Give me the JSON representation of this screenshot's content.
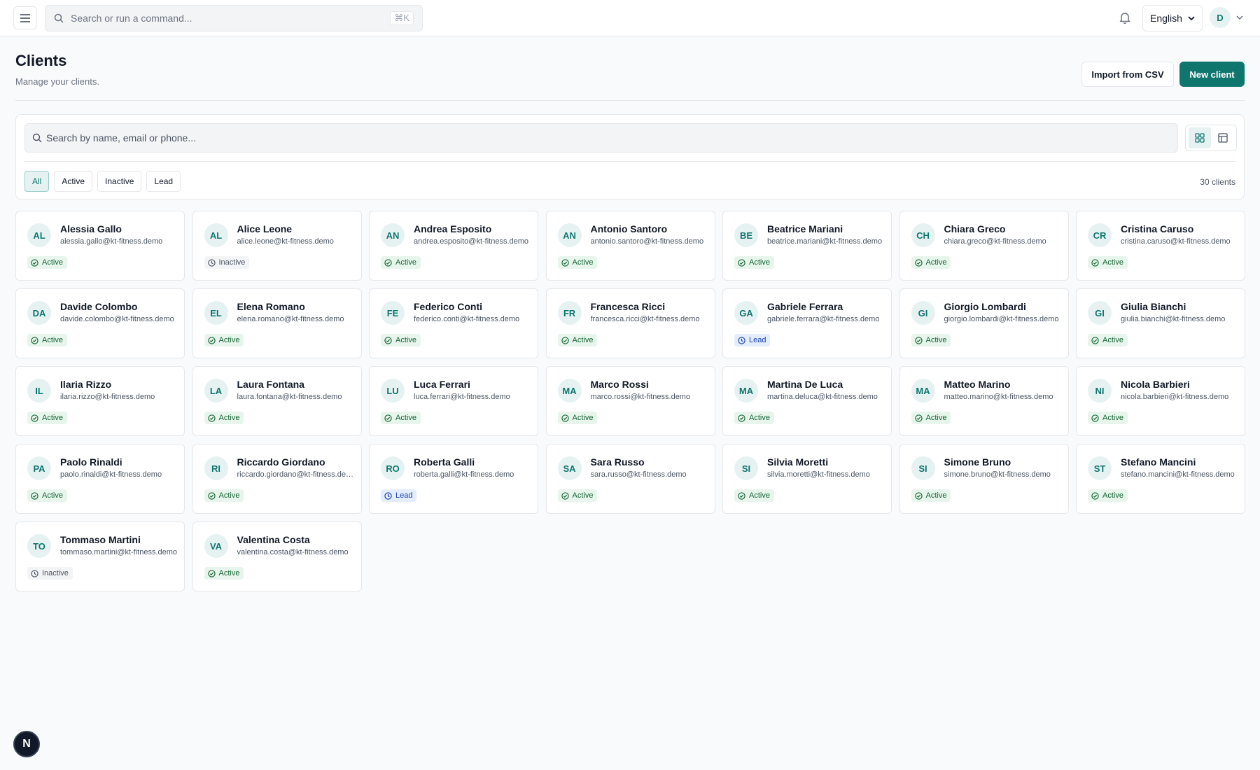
{
  "topbar": {
    "search_placeholder": "Search or run a command...",
    "shortcut": "⌘K",
    "language": "English",
    "user_initial": "D"
  },
  "header": {
    "title": "Clients",
    "subtitle": "Manage your clients.",
    "import_label": "Import from CSV",
    "new_label": "New client"
  },
  "filters": {
    "search_placeholder": "Search by name, email or phone...",
    "chips": [
      "All",
      "Active",
      "Inactive",
      "Lead"
    ],
    "selected": "All",
    "count": "30 clients"
  },
  "colors": {
    "accent": "#0f766e",
    "active": "#166534",
    "lead": "#1e40af",
    "inactive": "#4b5563"
  },
  "clients": [
    {
      "initials": "AL",
      "name": "Alessia Gallo",
      "email": "alessia.gallo@kt-fitness.demo",
      "status": "Active"
    },
    {
      "initials": "AL",
      "name": "Alice Leone",
      "email": "alice.leone@kt-fitness.demo",
      "status": "Inactive"
    },
    {
      "initials": "AN",
      "name": "Andrea Esposito",
      "email": "andrea.esposito@kt-fitness.demo",
      "status": "Active"
    },
    {
      "initials": "AN",
      "name": "Antonio Santoro",
      "email": "antonio.santoro@kt-fitness.demo",
      "status": "Active"
    },
    {
      "initials": "BE",
      "name": "Beatrice Mariani",
      "email": "beatrice.mariani@kt-fitness.demo",
      "status": "Active"
    },
    {
      "initials": "CH",
      "name": "Chiara Greco",
      "email": "chiara.greco@kt-fitness.demo",
      "status": "Active"
    },
    {
      "initials": "CR",
      "name": "Cristina Caruso",
      "email": "cristina.caruso@kt-fitness.demo",
      "status": "Active"
    },
    {
      "initials": "DA",
      "name": "Davide Colombo",
      "email": "davide.colombo@kt-fitness.demo",
      "status": "Active"
    },
    {
      "initials": "EL",
      "name": "Elena Romano",
      "email": "elena.romano@kt-fitness.demo",
      "status": "Active"
    },
    {
      "initials": "FE",
      "name": "Federico Conti",
      "email": "federico.conti@kt-fitness.demo",
      "status": "Active"
    },
    {
      "initials": "FR",
      "name": "Francesca Ricci",
      "email": "francesca.ricci@kt-fitness.demo",
      "status": "Active"
    },
    {
      "initials": "GA",
      "name": "Gabriele Ferrara",
      "email": "gabriele.ferrara@kt-fitness.demo",
      "status": "Lead"
    },
    {
      "initials": "GI",
      "name": "Giorgio Lombardi",
      "email": "giorgio.lombardi@kt-fitness.demo",
      "status": "Active"
    },
    {
      "initials": "GI",
      "name": "Giulia Bianchi",
      "email": "giulia.bianchi@kt-fitness.demo",
      "status": "Active"
    },
    {
      "initials": "IL",
      "name": "Ilaria Rizzo",
      "email": "ilaria.rizzo@kt-fitness.demo",
      "status": "Active"
    },
    {
      "initials": "LA",
      "name": "Laura Fontana",
      "email": "laura.fontana@kt-fitness.demo",
      "status": "Active"
    },
    {
      "initials": "LU",
      "name": "Luca Ferrari",
      "email": "luca.ferrari@kt-fitness.demo",
      "status": "Active"
    },
    {
      "initials": "MA",
      "name": "Marco Rossi",
      "email": "marco.rossi@kt-fitness.demo",
      "status": "Active"
    },
    {
      "initials": "MA",
      "name": "Martina De Luca",
      "email": "martina.deluca@kt-fitness.demo",
      "status": "Active"
    },
    {
      "initials": "MA",
      "name": "Matteo Marino",
      "email": "matteo.marino@kt-fitness.demo",
      "status": "Active"
    },
    {
      "initials": "NI",
      "name": "Nicola Barbieri",
      "email": "nicola.barbieri@kt-fitness.demo",
      "status": "Active"
    },
    {
      "initials": "PA",
      "name": "Paolo Rinaldi",
      "email": "paolo.rinaldi@kt-fitness.demo",
      "status": "Active"
    },
    {
      "initials": "RI",
      "name": "Riccardo Giordano",
      "email": "riccardo.giordano@kt-fitness.demo",
      "status": "Active"
    },
    {
      "initials": "RO",
      "name": "Roberta Galli",
      "email": "roberta.galli@kt-fitness.demo",
      "status": "Lead"
    },
    {
      "initials": "SA",
      "name": "Sara Russo",
      "email": "sara.russo@kt-fitness.demo",
      "status": "Active"
    },
    {
      "initials": "SI",
      "name": "Silvia Moretti",
      "email": "silvia.moretti@kt-fitness.demo",
      "status": "Active"
    },
    {
      "initials": "SI",
      "name": "Simone Bruno",
      "email": "simone.bruno@kt-fitness.demo",
      "status": "Active"
    },
    {
      "initials": "ST",
      "name": "Stefano Mancini",
      "email": "stefano.mancini@kt-fitness.demo",
      "status": "Active"
    },
    {
      "initials": "TO",
      "name": "Tommaso Martini",
      "email": "tommaso.martini@kt-fitness.demo",
      "status": "Inactive"
    },
    {
      "initials": "VA",
      "name": "Valentina Costa",
      "email": "valentina.costa@kt-fitness.demo",
      "status": "Active"
    }
  ],
  "fab_label": "N"
}
